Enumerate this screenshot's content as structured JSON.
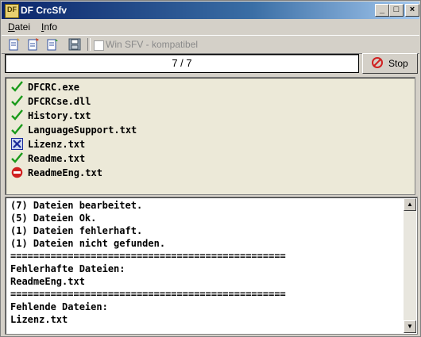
{
  "window": {
    "title": "DF CrcSfv",
    "app_icon_text": "DF"
  },
  "menu": [
    {
      "label": "Datei",
      "accel": "D",
      "rest": "atei"
    },
    {
      "label": "Info",
      "accel": "I",
      "rest": "nfo"
    }
  ],
  "toolbar": {
    "checkbox_label": "Win SFV - kompatibel",
    "checkbox_checked": false
  },
  "progress": {
    "text": "7 / 7",
    "fraction": 1.0
  },
  "stop_button": {
    "label": "Stop"
  },
  "files": [
    {
      "name": "DFCRC.exe",
      "status": "ok",
      "icon": "green-check-icon"
    },
    {
      "name": "DFCRCse.dll",
      "status": "ok",
      "icon": "green-check-icon"
    },
    {
      "name": "History.txt",
      "status": "ok",
      "icon": "green-check-icon"
    },
    {
      "name": "LanguageSupport.txt",
      "status": "ok",
      "icon": "green-check-icon"
    },
    {
      "name": "Lizenz.txt",
      "status": "error",
      "icon": "blue-x-icon"
    },
    {
      "name": "Readme.txt",
      "status": "ok",
      "icon": "green-check-icon"
    },
    {
      "name": "ReadmeEng.txt",
      "status": "missing",
      "icon": "red-stop-icon"
    }
  ],
  "log": [
    "(7) Dateien bearbeitet.",
    "(5) Dateien Ok.",
    "(1) Dateien fehlerhaft.",
    "(1) Dateien nicht gefunden.",
    "================================================",
    "Fehlerhafte Dateien:",
    "ReadmeEng.txt",
    "================================================",
    "Fehlende Dateien:",
    "Lizenz.txt"
  ],
  "colors": {
    "check": "#1a9a1a",
    "error": "#1a2a9a",
    "stop": "#d02020",
    "titlebar": "#0a246a"
  }
}
